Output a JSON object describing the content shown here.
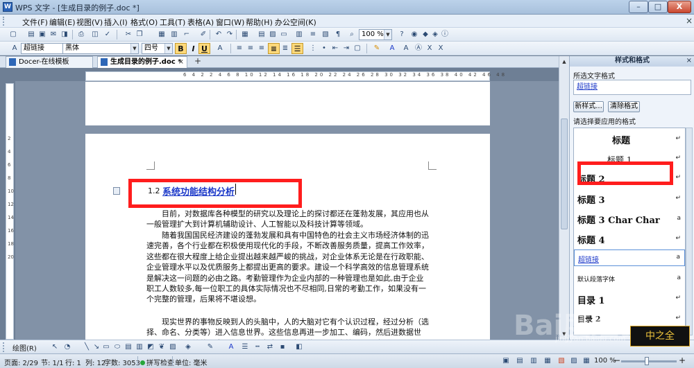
{
  "window": {
    "app_title": "WPS 文字 - [生成目录的例子.doc *]",
    "minimize": "–",
    "maximize": "□",
    "close": "X"
  },
  "menu": {
    "items": [
      "文件(F)",
      "编辑(E)",
      "视图(V)",
      "插入(I)",
      "格式(O)",
      "工具(T)",
      "表格(A)",
      "窗口(W)",
      "帮助(H)",
      "办公空间(K)"
    ],
    "close_label": "×"
  },
  "toolbar": {
    "zoom_value": "100 %",
    "style_value": "超链接",
    "font_value": "黑体",
    "size_value": "四号",
    "bold": "B",
    "italic": "I",
    "underline": "U"
  },
  "tabs": [
    {
      "label": "Docer-在线模板"
    },
    {
      "label": "生成目录的例子.doc *"
    }
  ],
  "new_tab_label": "+",
  "ruler": {
    "h_numbers": "6  4  2  2  4  6  8  10  12  14  16  18  20  22  24  26  28  30  32  34  36  38  40  42  46  48",
    "v_numbers": "2\n4\n6\n8\n10\n12\n14\n16\n18\n20"
  },
  "document": {
    "heading_number": "1.2",
    "heading_text": "系统功能结构分析",
    "paragraphs": [
      "目前，对数据库各种模型的研究以及理论上的探讨都还在蓬勃发展，其应用也从一般管理扩大到计算机辅助设计、人工智能以及科技计算等领域。",
      "随着我国国民经济建设的蓬勃发展和具有中国特色的社会主义市场经济体制的迅速完善，各个行业都在积极使用现代化的手段，不断改善服务质量，提高工作效率，这些都在很大程度上给企业提出越来越严峻的挑战，对企业体系无论是在行政职能、企业管理水平以及优质服务上都提出更高的要求。建设一个科学高效的信息管理系统是解决这一问题的必由之路。考勤管理作为企业内部的一种管理也是如此,由于企业职工人数较多,每一位职工的具体实际情况也不尽相同,日常的考勤工作，如果没有一个完整的管理，后果将不堪设想。",
      "现实世界的事物反映到人的头脑中，人的大脑对它有个认识过程，经过分析（选择、命名、分类等）进入信息世界。这些信息再进一步加工、编码，然后进数据世界，而软件系统的开发工作需要考虑这两个方面的问题，也就是要考虑系"
    ]
  },
  "styles_panel": {
    "title": "样式和格式",
    "close": "×",
    "selected_text_label": "所选文字格式",
    "current_style": "超链接",
    "new_style_button": "新样式...",
    "clear_format_button": "清除格式",
    "apply_label": "请选择要应用的格式",
    "styles": [
      {
        "label": "标题",
        "marker": "↵"
      },
      {
        "label": "标题 1",
        "marker": "↵"
      },
      {
        "label": "标题 2",
        "marker": "↵"
      },
      {
        "label": "标题 3",
        "marker": "↵"
      },
      {
        "label": "标题 3 Char Char",
        "marker": "a"
      },
      {
        "label": "标题 4",
        "marker": "↵"
      },
      {
        "label": "超链接",
        "marker": "a"
      },
      {
        "label": "默认段落字体",
        "marker": "a"
      },
      {
        "label": "目录 1",
        "marker": "↵"
      },
      {
        "label": "目录 2",
        "marker": "↵"
      }
    ]
  },
  "drawbar": {
    "label": "绘图(R)"
  },
  "status": {
    "page": "页面: 2/29",
    "section": "节: 1/1",
    "row": "行: 1",
    "col": "列: 12",
    "words": "字数: 3053",
    "spell": "拼写检查",
    "unit": "单位: 毫米",
    "zoom": "100 %"
  },
  "watermark": {
    "brand": "Bai度经验",
    "url": "jingyan.baidu.com",
    "logo_text": "中之全"
  },
  "colors": {
    "accent_red": "#ff1d1d",
    "link_blue": "#1c39c9"
  }
}
